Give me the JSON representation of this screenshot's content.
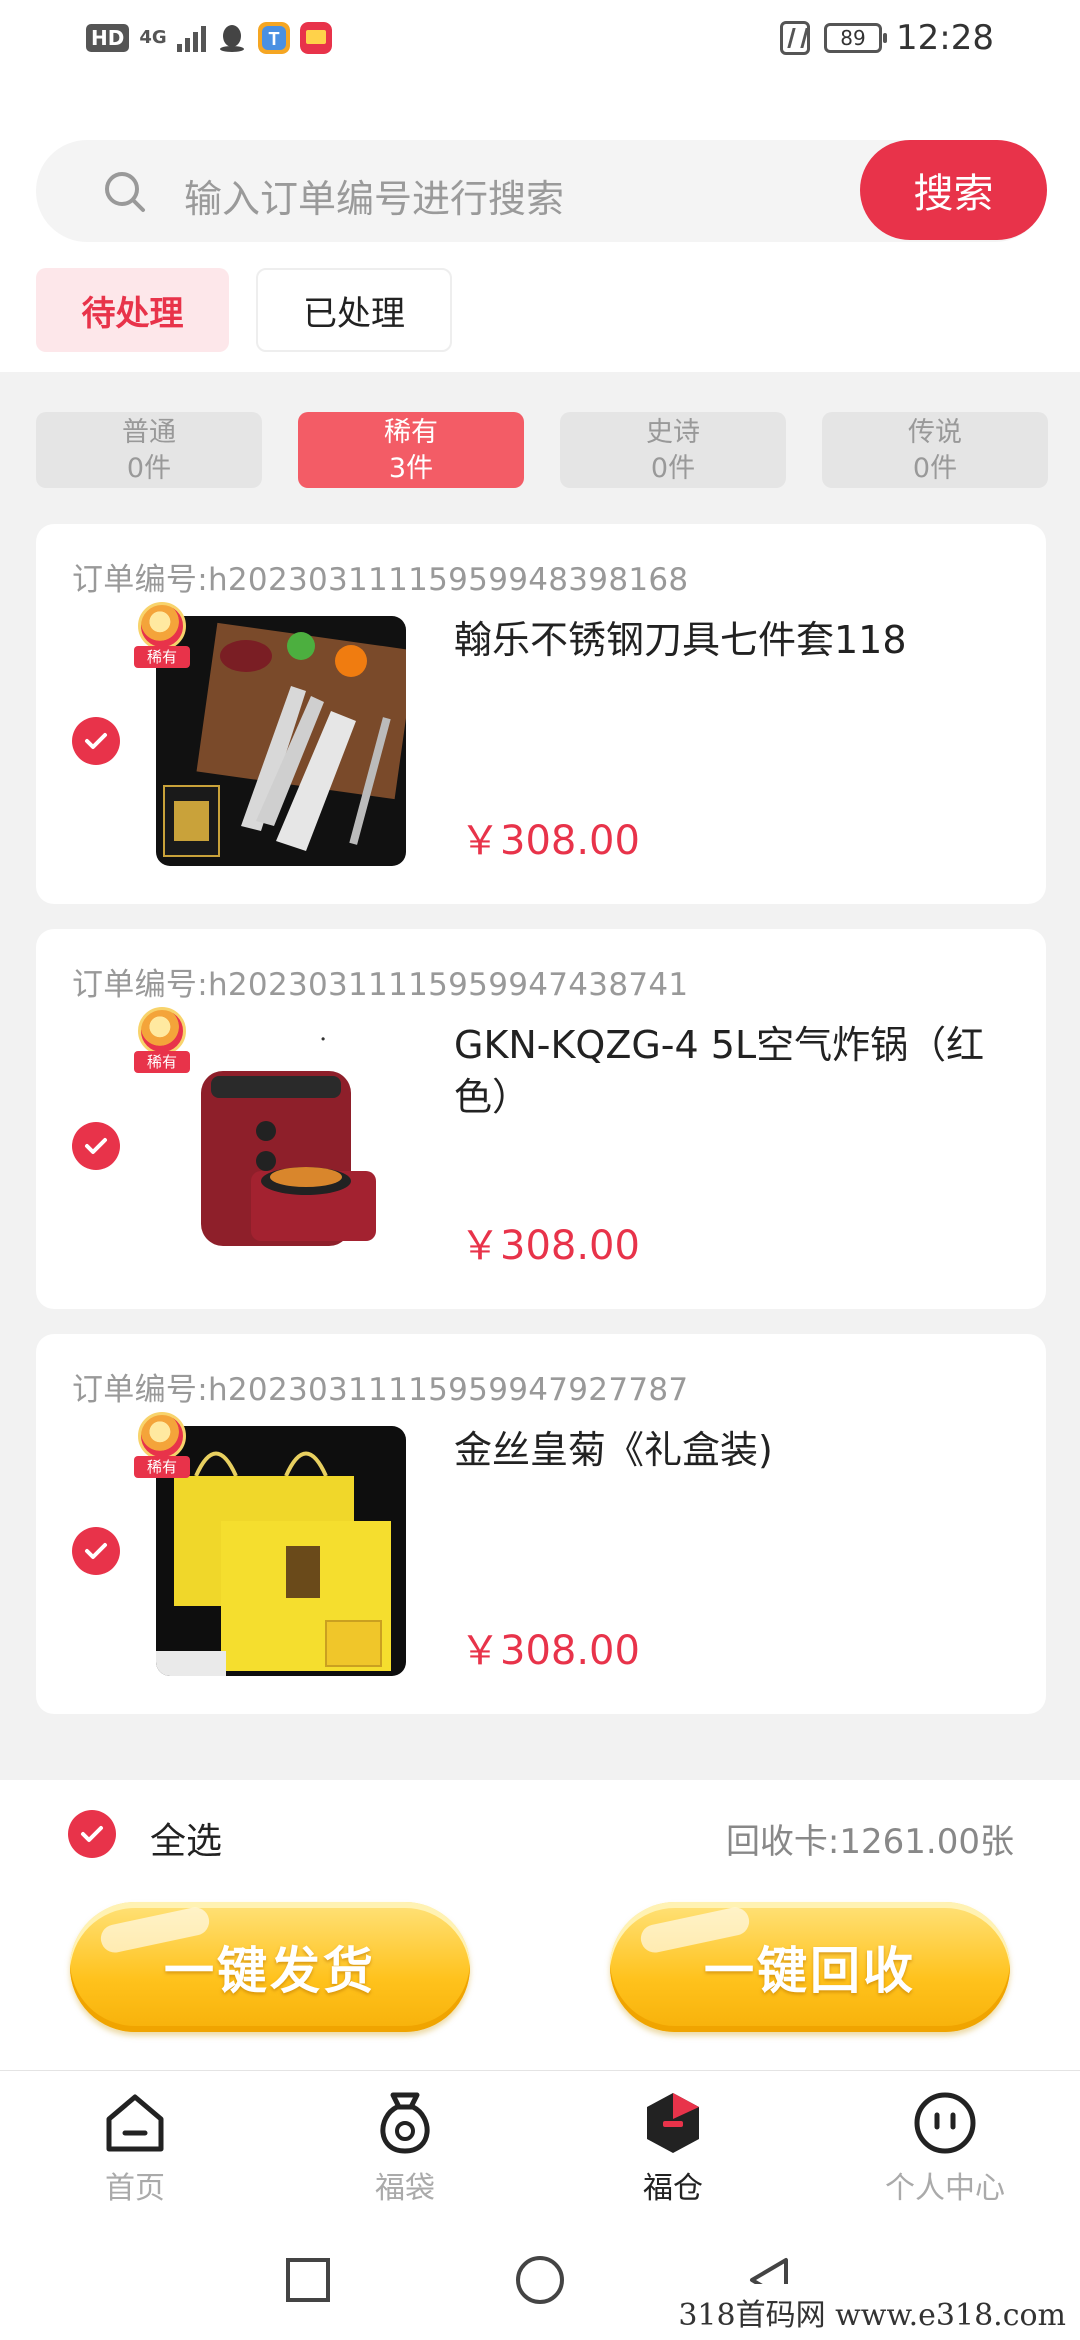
{
  "status_bar": {
    "hd": "HD",
    "network": "4G",
    "battery": "89",
    "time": "12:28"
  },
  "search": {
    "placeholder": "输入订单编号进行搜索",
    "button_label": "搜索"
  },
  "tabs": [
    {
      "label": "待处理",
      "active": true
    },
    {
      "label": "已处理",
      "active": false
    }
  ],
  "rarity_filters": [
    {
      "name": "普通",
      "count": "0件",
      "active": false
    },
    {
      "name": "稀有",
      "count": "3件",
      "active": true
    },
    {
      "name": "史诗",
      "count": "0件",
      "active": false
    },
    {
      "name": "传说",
      "count": "0件",
      "active": false
    }
  ],
  "orders": [
    {
      "order_label": "订单编号:h20230311115959948398168",
      "badge": "稀有",
      "product_name": "翰乐不锈钢刀具七件套118",
      "price": "￥308.00",
      "checked": true
    },
    {
      "order_label": "订单编号:h20230311115959947438741",
      "badge": "稀有",
      "product_name": "GKN-KQZG-4 5L空气炸锅（红色）",
      "price": "￥308.00",
      "checked": true
    },
    {
      "order_label": "订单编号:h20230311115959947927787",
      "badge": "稀有",
      "product_name": "金丝皇菊《礼盒装)",
      "price": "￥308.00",
      "checked": true
    }
  ],
  "footer": {
    "select_all_label": "全选",
    "recycle_card_text": "回收卡:1261.00张",
    "ship_button_label": "一键发货",
    "recycle_button_label": "一键回收"
  },
  "bottom_nav": [
    {
      "label": "首页",
      "icon": "home-icon",
      "active": false
    },
    {
      "label": "福袋",
      "icon": "lucky-bag-icon",
      "active": false
    },
    {
      "label": "福仓",
      "icon": "warehouse-icon",
      "active": true
    },
    {
      "label": "个人中心",
      "icon": "profile-icon",
      "active": false
    }
  ],
  "watermark": "318首码网 www.e318.com",
  "colors": {
    "accent": "#e8334a",
    "active_filter": "#f35c66",
    "button_yellow": "#ffc21c"
  }
}
